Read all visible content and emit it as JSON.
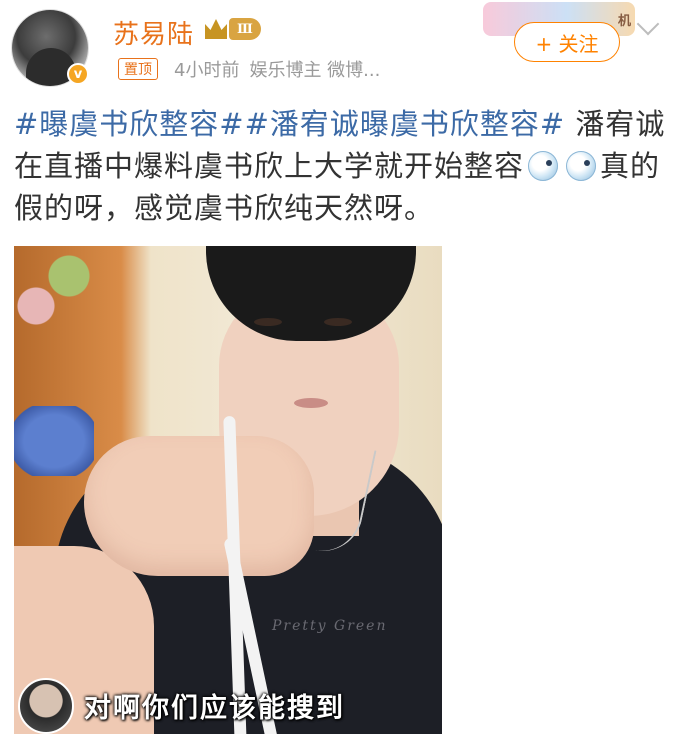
{
  "author": {
    "name": "苏易陆",
    "vip_level": "Ⅲ",
    "verified_mark": "v",
    "pinned_tag": "置顶",
    "time": "4小时前",
    "role": "娱乐博主 微博..."
  },
  "header": {
    "follow_label": "+ 关注",
    "card_ribbon_text": "机"
  },
  "post": {
    "topic_1": "#曝虞书欣整容#",
    "topic_2": "#潘宥诚曝虞书欣整容#",
    "text_1": " 潘宥诚在直播中爆料虞书欣上大学就开始整容",
    "text_2": "真的假的呀，感觉虞书欣纯天然呀。"
  },
  "video": {
    "subtitle": "对啊你们应该能搜到",
    "shirt_print": "Pretty Green"
  },
  "colors": {
    "accent_orange": "#ff8200",
    "username_orange": "#e8721b",
    "topic_blue": "#3c6aa6"
  }
}
